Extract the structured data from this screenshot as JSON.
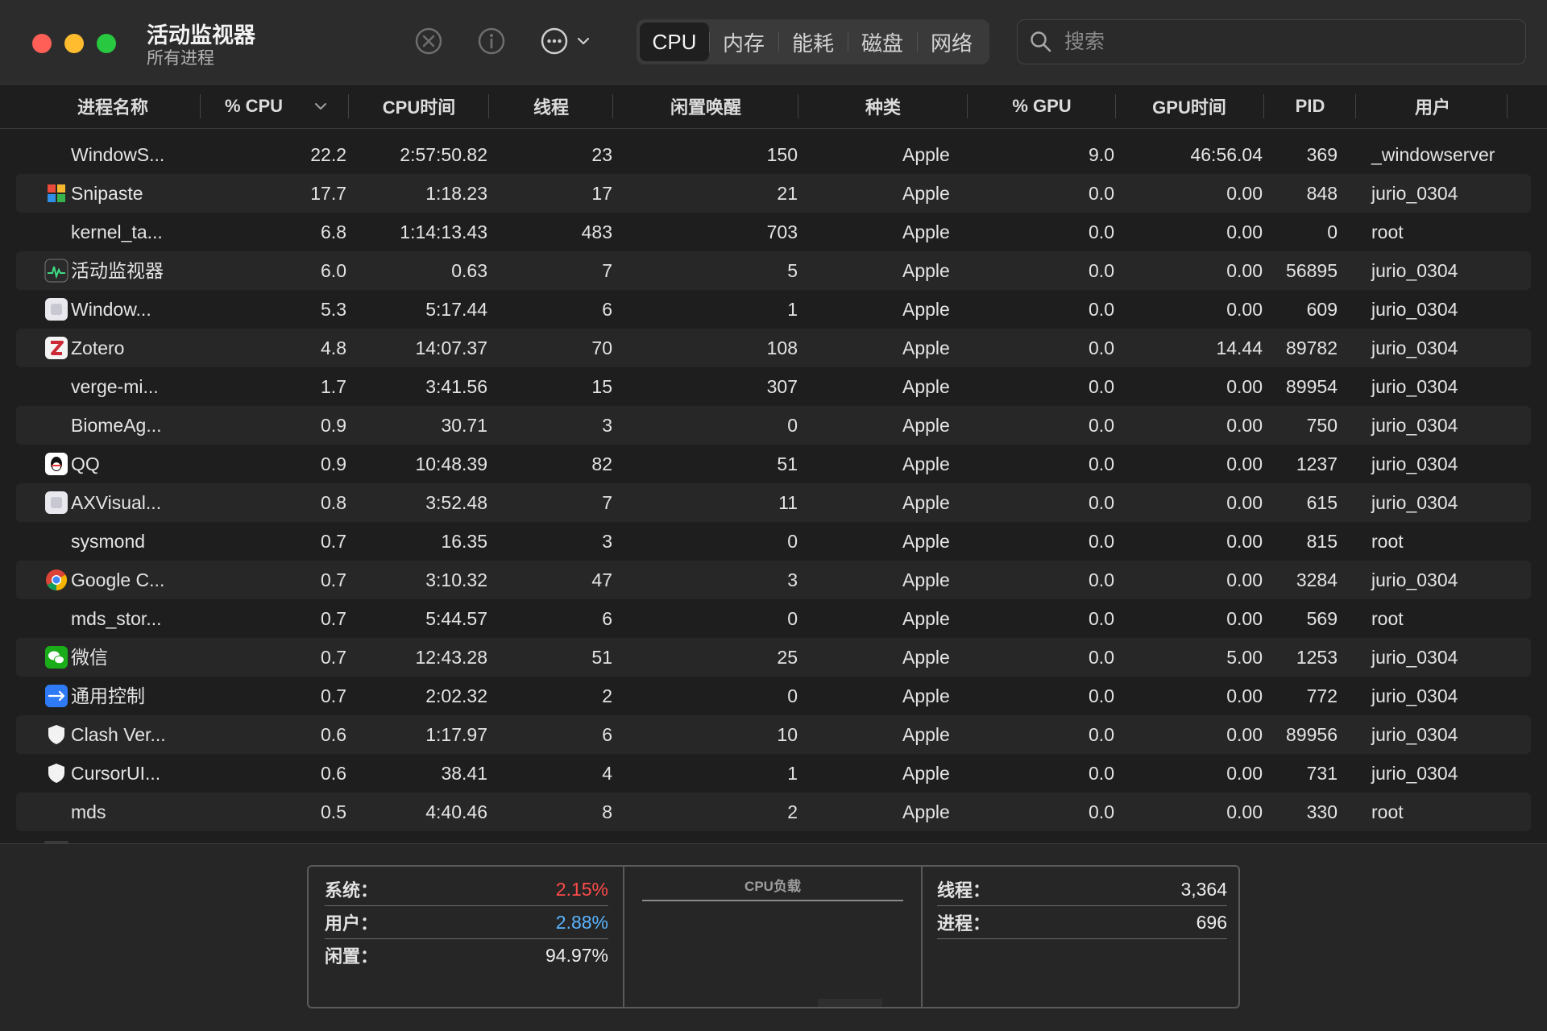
{
  "window": {
    "title": "活动监视器",
    "subtitle": "所有进程"
  },
  "toolbar": {
    "stop_icon": "x-circle-icon",
    "info_icon": "info-circle-icon",
    "more_icon": "ellipsis-circle-icon",
    "tabs": [
      "CPU",
      "内存",
      "能耗",
      "磁盘",
      "网络"
    ],
    "active_tab": "CPU",
    "search_placeholder": "搜索"
  },
  "columns": [
    "进程名称",
    "% CPU",
    "CPU时间",
    "线程",
    "闲置唤醒",
    "种类",
    "% GPU",
    "GPU时间",
    "PID",
    "用户"
  ],
  "sort_column": "% CPU",
  "processes": [
    {
      "name": "WindowS...",
      "cpu": "22.2",
      "cpu_time": "2:57:50.82",
      "threads": "23",
      "idle_wake": "150",
      "kind": "Apple",
      "gpu": "9.0",
      "gpu_time": "46:56.04",
      "pid": "369",
      "user": "_windowserver",
      "icon": "none"
    },
    {
      "name": "Snipaste",
      "cpu": "17.7",
      "cpu_time": "1:18.23",
      "threads": "17",
      "idle_wake": "21",
      "kind": "Apple",
      "gpu": "0.0",
      "gpu_time": "0.00",
      "pid": "848",
      "user": "jurio_0304",
      "icon": "snipaste-icon"
    },
    {
      "name": "kernel_ta...",
      "cpu": "6.8",
      "cpu_time": "1:14:13.43",
      "threads": "483",
      "idle_wake": "703",
      "kind": "Apple",
      "gpu": "0.0",
      "gpu_time": "0.00",
      "pid": "0",
      "user": "root",
      "icon": "none"
    },
    {
      "name": "活动监视器",
      "cpu": "6.0",
      "cpu_time": "0.63",
      "threads": "7",
      "idle_wake": "5",
      "kind": "Apple",
      "gpu": "0.0",
      "gpu_time": "0.00",
      "pid": "56895",
      "user": "jurio_0304",
      "icon": "activity-monitor-icon"
    },
    {
      "name": "Window...",
      "cpu": "5.3",
      "cpu_time": "5:17.44",
      "threads": "6",
      "idle_wake": "1",
      "kind": "Apple",
      "gpu": "0.0",
      "gpu_time": "0.00",
      "pid": "609",
      "user": "jurio_0304",
      "icon": "generic-app-icon"
    },
    {
      "name": "Zotero",
      "cpu": "4.8",
      "cpu_time": "14:07.37",
      "threads": "70",
      "idle_wake": "108",
      "kind": "Apple",
      "gpu": "0.0",
      "gpu_time": "14.44",
      "pid": "89782",
      "user": "jurio_0304",
      "icon": "zotero-icon"
    },
    {
      "name": "verge-mi...",
      "cpu": "1.7",
      "cpu_time": "3:41.56",
      "threads": "15",
      "idle_wake": "307",
      "kind": "Apple",
      "gpu": "0.0",
      "gpu_time": "0.00",
      "pid": "89954",
      "user": "jurio_0304",
      "icon": "none"
    },
    {
      "name": "BiomeAg...",
      "cpu": "0.9",
      "cpu_time": "30.71",
      "threads": "3",
      "idle_wake": "0",
      "kind": "Apple",
      "gpu": "0.0",
      "gpu_time": "0.00",
      "pid": "750",
      "user": "jurio_0304",
      "icon": "none"
    },
    {
      "name": "QQ",
      "cpu": "0.9",
      "cpu_time": "10:48.39",
      "threads": "82",
      "idle_wake": "51",
      "kind": "Apple",
      "gpu": "0.0",
      "gpu_time": "0.00",
      "pid": "1237",
      "user": "jurio_0304",
      "icon": "qq-icon"
    },
    {
      "name": "AXVisual...",
      "cpu": "0.8",
      "cpu_time": "3:52.48",
      "threads": "7",
      "idle_wake": "11",
      "kind": "Apple",
      "gpu": "0.0",
      "gpu_time": "0.00",
      "pid": "615",
      "user": "jurio_0304",
      "icon": "generic-app-icon"
    },
    {
      "name": "sysmond",
      "cpu": "0.7",
      "cpu_time": "16.35",
      "threads": "3",
      "idle_wake": "0",
      "kind": "Apple",
      "gpu": "0.0",
      "gpu_time": "0.00",
      "pid": "815",
      "user": "root",
      "icon": "none"
    },
    {
      "name": "Google C...",
      "cpu": "0.7",
      "cpu_time": "3:10.32",
      "threads": "47",
      "idle_wake": "3",
      "kind": "Apple",
      "gpu": "0.0",
      "gpu_time": "0.00",
      "pid": "3284",
      "user": "jurio_0304",
      "icon": "chrome-icon"
    },
    {
      "name": "mds_stor...",
      "cpu": "0.7",
      "cpu_time": "5:44.57",
      "threads": "6",
      "idle_wake": "0",
      "kind": "Apple",
      "gpu": "0.0",
      "gpu_time": "0.00",
      "pid": "569",
      "user": "root",
      "icon": "none"
    },
    {
      "name": "微信",
      "cpu": "0.7",
      "cpu_time": "12:43.28",
      "threads": "51",
      "idle_wake": "25",
      "kind": "Apple",
      "gpu": "0.0",
      "gpu_time": "5.00",
      "pid": "1253",
      "user": "jurio_0304",
      "icon": "wechat-icon"
    },
    {
      "name": "通用控制",
      "cpu": "0.7",
      "cpu_time": "2:02.32",
      "threads": "2",
      "idle_wake": "0",
      "kind": "Apple",
      "gpu": "0.0",
      "gpu_time": "0.00",
      "pid": "772",
      "user": "jurio_0304",
      "icon": "universal-control-icon"
    },
    {
      "name": "Clash Ver...",
      "cpu": "0.6",
      "cpu_time": "1:17.97",
      "threads": "6",
      "idle_wake": "10",
      "kind": "Apple",
      "gpu": "0.0",
      "gpu_time": "0.00",
      "pid": "89956",
      "user": "jurio_0304",
      "icon": "shield-icon"
    },
    {
      "name": "CursorUI...",
      "cpu": "0.6",
      "cpu_time": "38.41",
      "threads": "4",
      "idle_wake": "1",
      "kind": "Apple",
      "gpu": "0.0",
      "gpu_time": "0.00",
      "pid": "731",
      "user": "jurio_0304",
      "icon": "shield-icon"
    },
    {
      "name": "mds",
      "cpu": "0.5",
      "cpu_time": "4:40.46",
      "threads": "8",
      "idle_wake": "2",
      "kind": "Apple",
      "gpu": "0.0",
      "gpu_time": "0.00",
      "pid": "330",
      "user": "root",
      "icon": "none"
    }
  ],
  "stats": {
    "system_label": "系统：",
    "system_value": "2.15%",
    "user_label": "用户：",
    "user_value": "2.88%",
    "idle_label": "闲置：",
    "idle_value": "94.97%",
    "cpu_load_title": "CPU负载",
    "threads_label": "线程：",
    "threads_value": "3,364",
    "processes_label": "进程：",
    "processes_value": "696"
  },
  "colors": {
    "system_value": "#ff4a4a",
    "user_value": "#5ab4ff",
    "alt_row": "#272727",
    "background": "#1e1e1e"
  }
}
